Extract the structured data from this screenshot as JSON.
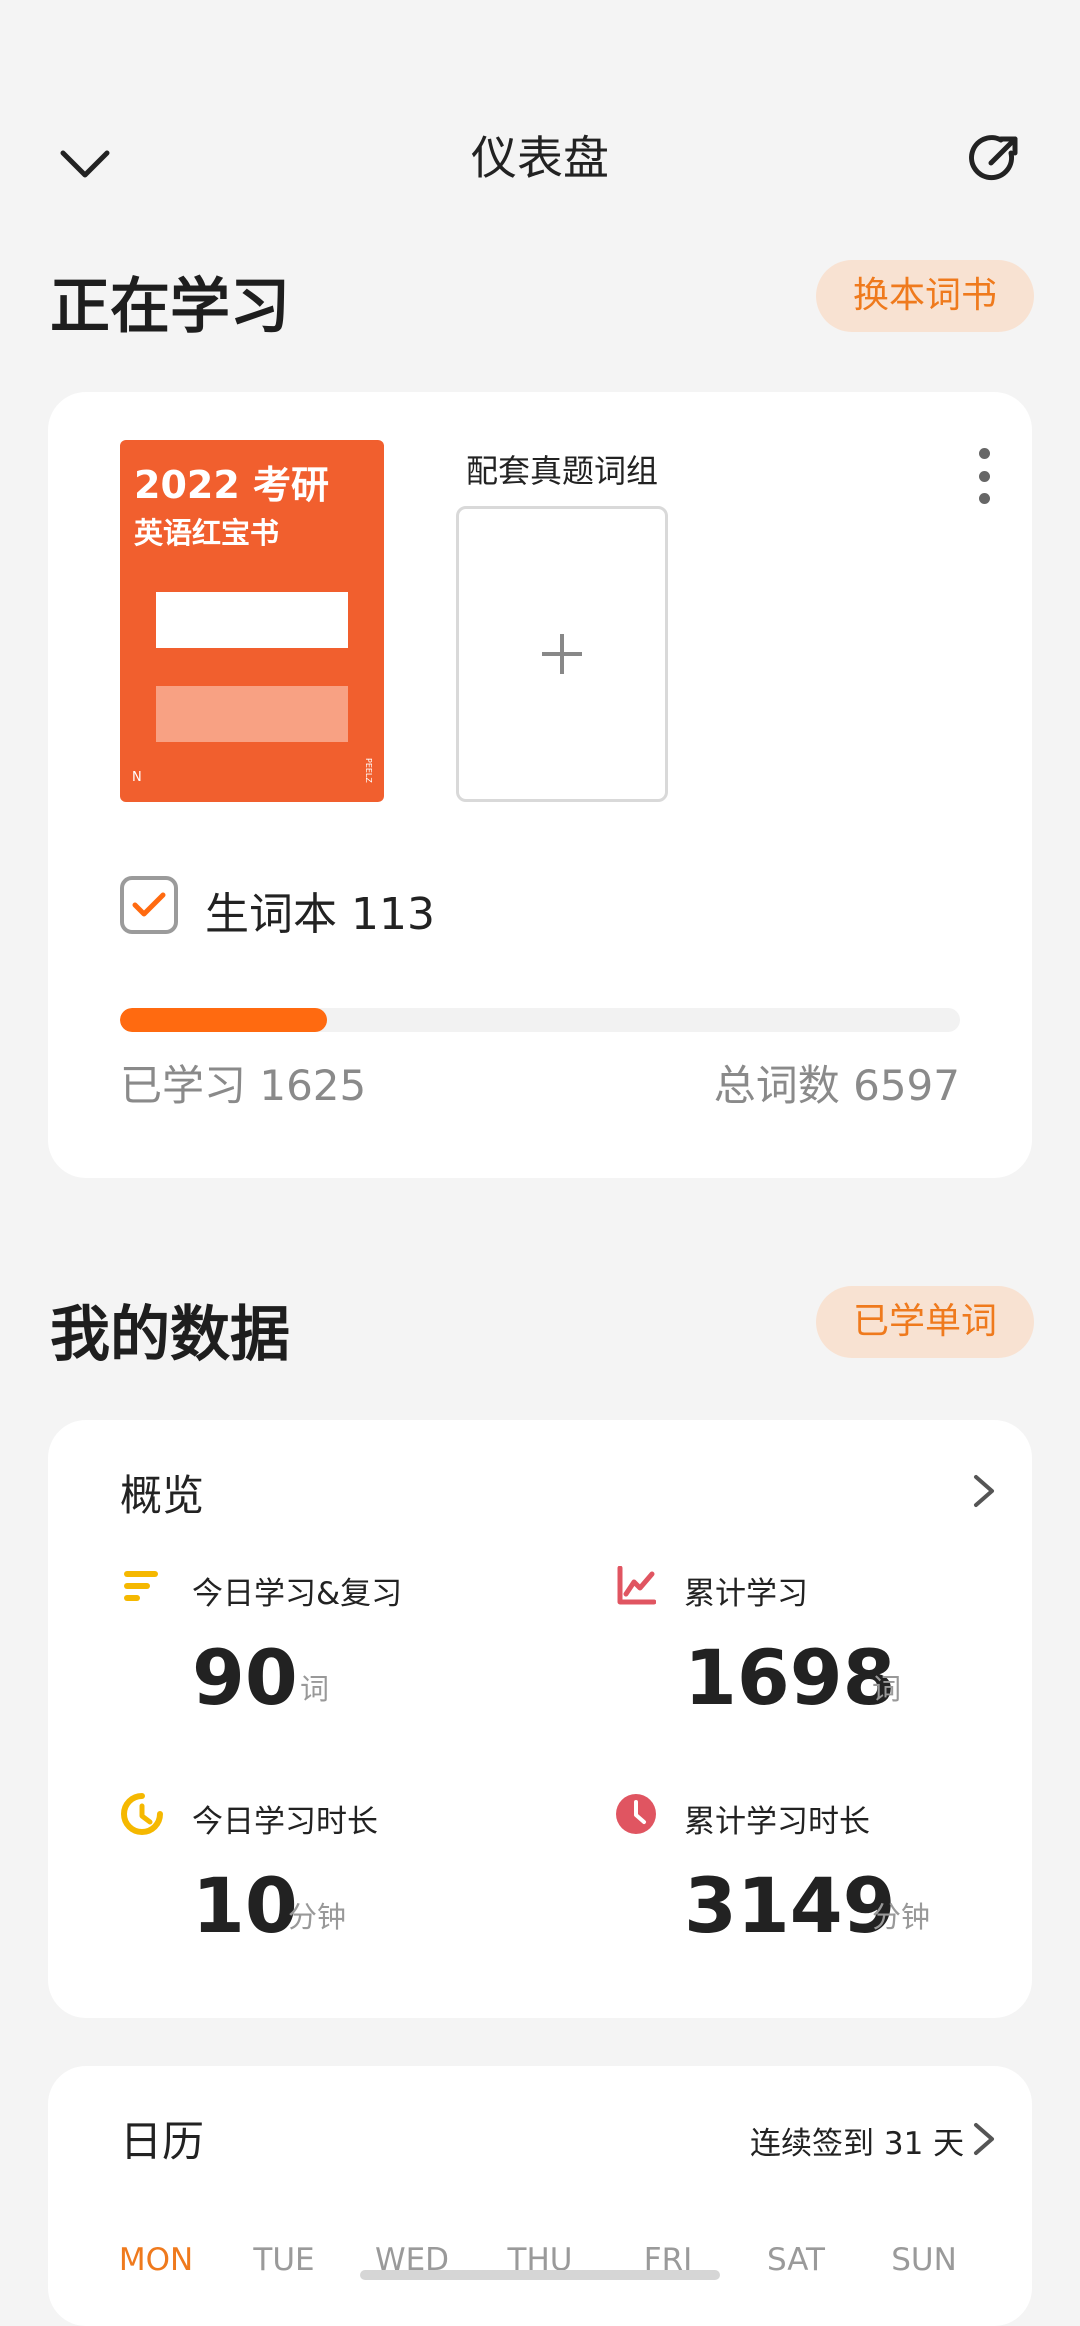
{
  "header": {
    "title": "仪表盘"
  },
  "studying": {
    "title": "正在学习",
    "change_book_label": "换本词书",
    "cover": {
      "line1": "2022 考研",
      "line2": "英语红宝书",
      "corner": "N",
      "side": "PEELZ"
    },
    "group_label": "配套真题词组",
    "vocab_label": "生词本 113",
    "vocab_checked": true,
    "progress_fraction": 0.246,
    "learned_label": "已学习 1625",
    "total_label": "总词数 6597"
  },
  "mydata": {
    "title": "我的数据",
    "learned_words_label": "已学单词",
    "overview": {
      "title": "概览",
      "stats": [
        {
          "label": "今日学习&复习",
          "value": "90",
          "unit": "词",
          "icon": "list-bars-icon",
          "color": "#f5b800"
        },
        {
          "label": "累计学习",
          "value": "1698",
          "unit": "词",
          "icon": "line-chart-icon",
          "color": "#e05561"
        },
        {
          "label": "今日学习时长",
          "value": "10",
          "unit": "分钟",
          "icon": "timer-swirl-icon",
          "color": "#f5b800"
        },
        {
          "label": "累计学习时长",
          "value": "3149",
          "unit": "分钟",
          "icon": "clock-icon",
          "color": "#e05561"
        }
      ]
    },
    "calendar": {
      "title": "日历",
      "streak_label": "连续签到 31 天",
      "days": [
        "MON",
        "TUE",
        "WED",
        "THU",
        "FRI",
        "SAT",
        "SUN"
      ],
      "active_day": "MON"
    }
  },
  "colors": {
    "accent": "#ef7a1d",
    "progress": "#ff6a10",
    "cover": "#f15f2e"
  }
}
